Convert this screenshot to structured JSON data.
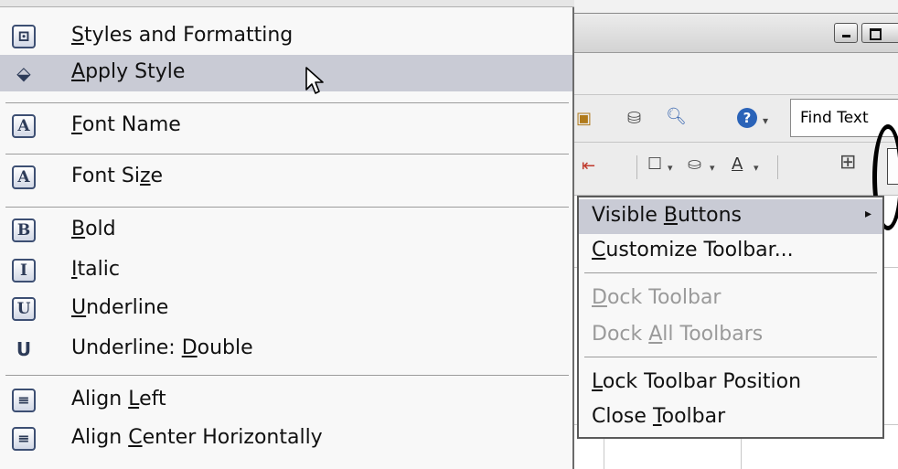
{
  "left_menu": {
    "items": [
      {
        "pre": "",
        "u": "S",
        "post": "tyles and Formatting",
        "icon": "styles-icon",
        "highlighted": false
      },
      {
        "pre": "",
        "u": "A",
        "post": "pply Style",
        "icon": "paint-bucket-icon",
        "highlighted": true
      },
      {
        "pre": "",
        "u": "F",
        "post": "ont Name",
        "icon": "font-name-icon",
        "highlighted": false
      },
      {
        "pre": "Font Si",
        "u": "z",
        "post": "e",
        "icon": "font-size-icon",
        "highlighted": false
      },
      {
        "pre": "",
        "u": "B",
        "post": "old",
        "icon": "bold-icon",
        "highlighted": false
      },
      {
        "pre": "",
        "u": "I",
        "post": "talic",
        "icon": "italic-icon",
        "highlighted": false
      },
      {
        "pre": "",
        "u": "U",
        "post": "nderline",
        "icon": "underline-icon",
        "highlighted": false
      },
      {
        "pre": "Underline: ",
        "u": "D",
        "post": "ouble",
        "icon": "double-underline-icon",
        "highlighted": false
      },
      {
        "pre": "Align ",
        "u": "L",
        "post": "eft",
        "icon": "align-left-icon",
        "highlighted": false
      },
      {
        "pre": "Align ",
        "u": "C",
        "post": "enter Horizontally",
        "icon": "align-center-icon",
        "highlighted": false
      }
    ],
    "icon_glyphs": [
      "⊡",
      "⬙",
      "A",
      "A",
      "B",
      "I",
      "U",
      "U",
      "≡",
      "≡"
    ]
  },
  "context_menu": {
    "items": [
      {
        "pre": "Visible ",
        "u": "B",
        "post": "uttons",
        "has_submenu": true,
        "disabled": false,
        "highlighted": true
      },
      {
        "pre": "",
        "u": "C",
        "post": "ustomize Toolbar...",
        "has_submenu": false,
        "disabled": false,
        "highlighted": false
      },
      {
        "pre": "",
        "u": "D",
        "post": "ock Toolbar",
        "has_submenu": false,
        "disabled": true,
        "highlighted": false
      },
      {
        "pre": "Dock ",
        "u": "A",
        "post": "ll Toolbars",
        "has_submenu": false,
        "disabled": true,
        "highlighted": false
      },
      {
        "pre": "",
        "u": "L",
        "post": "ock Toolbar Position",
        "has_submenu": false,
        "disabled": false,
        "highlighted": false
      },
      {
        "pre": "Close ",
        "u": "T",
        "post": "oolbar",
        "has_submenu": false,
        "disabled": false,
        "highlighted": false
      }
    ],
    "submenu_arrow": "▸"
  },
  "toolbar": {
    "find_text": "Find Text",
    "help_glyph": "?"
  },
  "colors": {
    "highlight": "#c9cbd5",
    "disabled_text": "#9a9a9a",
    "menu_bg": "#f8f8f8"
  }
}
